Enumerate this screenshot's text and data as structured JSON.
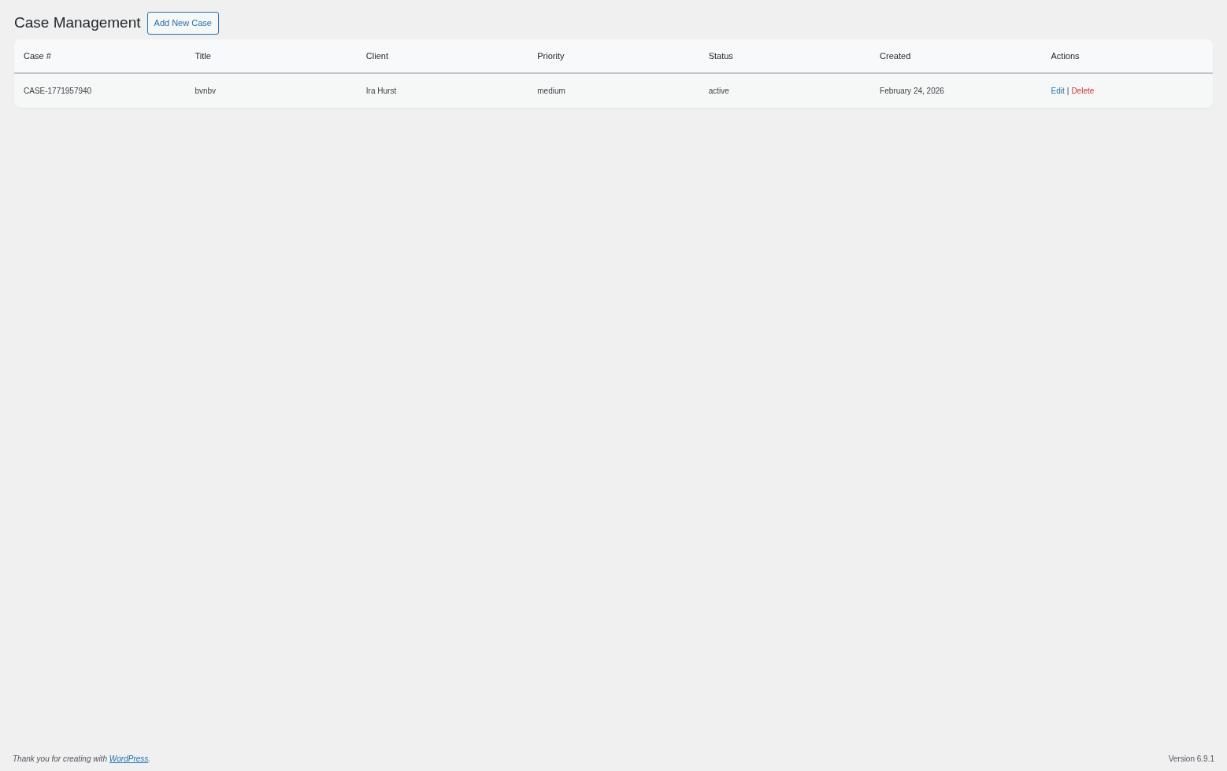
{
  "page_title": "Case Management",
  "add_button": "Add New Case",
  "table": {
    "columns": [
      "Case #",
      "Title",
      "Client",
      "Priority",
      "Status",
      "Created",
      "Actions"
    ],
    "rows": [
      {
        "cells": [
          "CASE-1771957940",
          "bvnbv",
          "Ira Hurst",
          "medium",
          "active",
          "February 24, 2026"
        ],
        "actions": [
          {
            "kind": "edit",
            "label": "Edit"
          },
          {
            "kind": "delete",
            "label": "Delete"
          }
        ],
        "separator": "|"
      }
    ]
  },
  "footer": {
    "text_before": "Thank you for creating with ",
    "link": "WordPress",
    "text_after": ".",
    "version": "Version 6.9.1"
  }
}
